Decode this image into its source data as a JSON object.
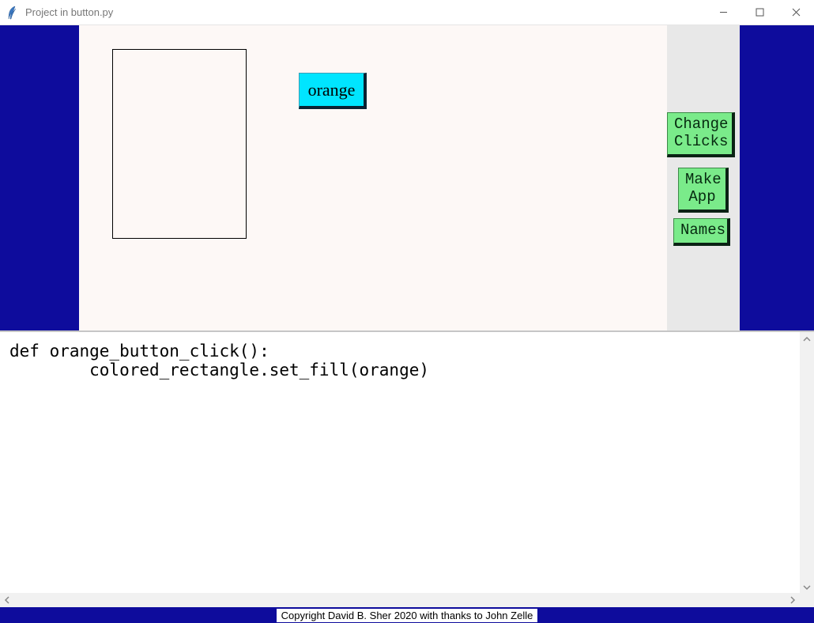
{
  "window": {
    "title": "Project in button.py"
  },
  "canvas": {
    "orange_button_label": "orange"
  },
  "sidebar": {
    "change_clicks": "Change\nClicks",
    "make_app": "Make\nApp",
    "names": "Names"
  },
  "code": {
    "text": "def orange_button_click():\n        colored_rectangle.set_fill(orange)"
  },
  "footer": {
    "copyright": "Copyright David B. Sher 2020 with thanks to John Zelle"
  }
}
